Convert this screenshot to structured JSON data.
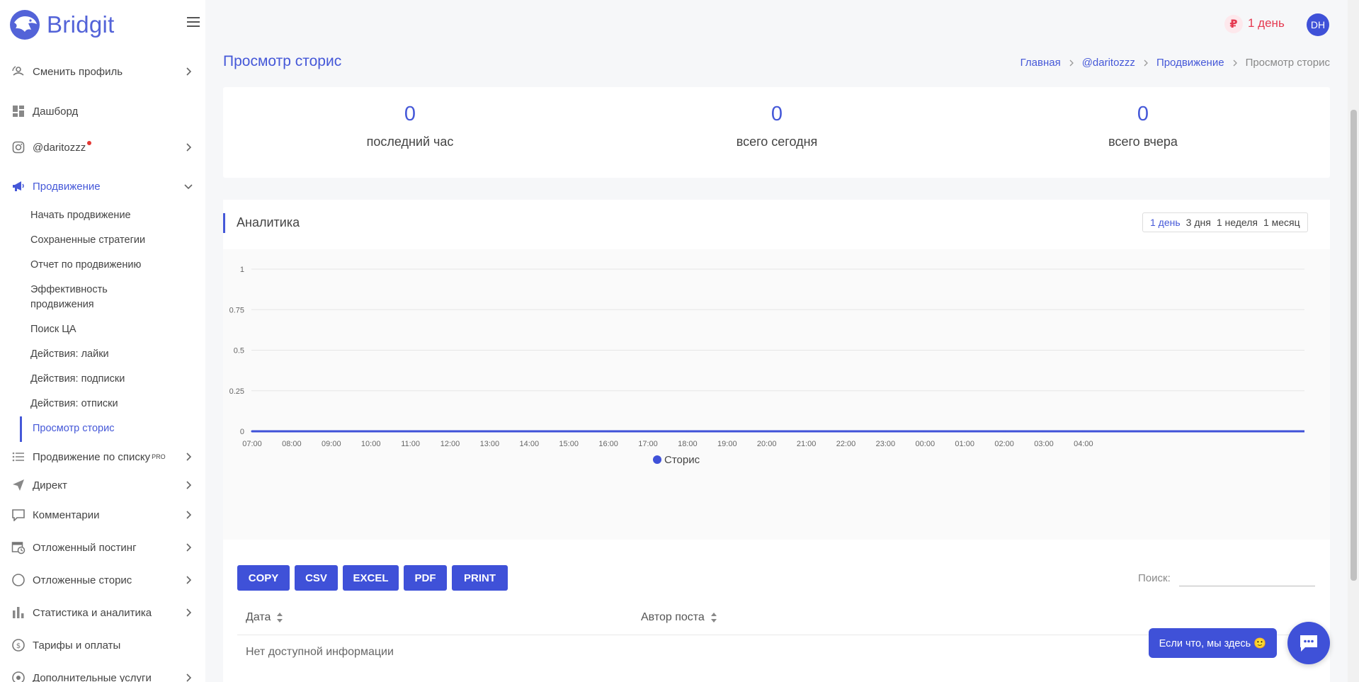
{
  "brand": {
    "name": "Bridgit"
  },
  "sidebar": {
    "items": [
      {
        "label": "Сменить профиль",
        "icon": "profile-switch-icon"
      },
      {
        "label": "Дашборд",
        "icon": "dashboard-icon"
      },
      {
        "label": "@daritozzz",
        "icon": "instagram-icon"
      },
      {
        "label": "Продвижение",
        "icon": "megaphone-icon"
      },
      {
        "label": "Продвижение по списку",
        "sup": "PRO",
        "icon": "list-icon"
      },
      {
        "label": "Директ",
        "icon": "send-icon"
      },
      {
        "label": "Комментарии",
        "icon": "comment-icon"
      },
      {
        "label": "Отложенный постинг",
        "icon": "calendar-clock-icon"
      },
      {
        "label": "Отложенные сторис",
        "icon": "circle-icon"
      },
      {
        "label": "Статистика и аналитика",
        "icon": "bar-chart-icon"
      },
      {
        "label": "Тарифы и оплаты",
        "icon": "dollar-icon"
      },
      {
        "label": "Дополнительные услуги",
        "icon": "services-icon"
      }
    ],
    "subitems": [
      "Начать продвижение",
      "Сохраненные стратегии",
      "Отчет по продвижению",
      "Эффективность продвижения",
      "Поиск ЦА",
      "Действия: лайки",
      "Действия: подписки",
      "Действия: отписки",
      "Просмотр сторис"
    ]
  },
  "topbar": {
    "currency_symbol": "₽",
    "plan": "1 день",
    "avatar": "DH"
  },
  "page": {
    "title": "Просмотр сторис",
    "breadcrumb": [
      "Главная",
      "@daritozzz",
      "Продвижение",
      "Просмотр сторис"
    ]
  },
  "stats": [
    {
      "value": "0",
      "label": "последний час"
    },
    {
      "value": "0",
      "label": "всего сегодня"
    },
    {
      "value": "0",
      "label": "всего вчера"
    }
  ],
  "analytics": {
    "title": "Аналитика",
    "ranges": [
      "1 день",
      "3 дня",
      "1 неделя",
      "1 месяц"
    ],
    "selected_range": "1 день"
  },
  "chart_data": {
    "type": "line",
    "x": [
      "07:00",
      "08:00",
      "09:00",
      "10:00",
      "11:00",
      "12:00",
      "13:00",
      "14:00",
      "15:00",
      "16:00",
      "17:00",
      "18:00",
      "19:00",
      "20:00",
      "21:00",
      "22:00",
      "23:00",
      "00:00",
      "01:00",
      "02:00",
      "03:00",
      "04:00"
    ],
    "series": [
      {
        "name": "Сторис",
        "values": [
          0,
          0,
          0,
          0,
          0,
          0,
          0,
          0,
          0,
          0,
          0,
          0,
          0,
          0,
          0,
          0,
          0,
          0,
          0,
          0,
          0,
          0
        ],
        "color": "#3f51d8"
      }
    ],
    "yticks": [
      "0",
      "0.25",
      "0.5",
      "0.75",
      "1"
    ],
    "ylim": [
      0,
      1
    ],
    "grid": true,
    "legend": "bottom"
  },
  "table": {
    "export_buttons": [
      "COPY",
      "CSV",
      "EXCEL",
      "PDF",
      "PRINT"
    ],
    "search_label": "Поиск:",
    "search_value": "",
    "columns": [
      "Дата",
      "Автор поста"
    ],
    "empty_text": "Нет доступной информации"
  },
  "chat": {
    "label": "Если что, мы здесь 🙂"
  },
  "colors": {
    "accent": "#4558d8",
    "danger": "#e53950"
  }
}
